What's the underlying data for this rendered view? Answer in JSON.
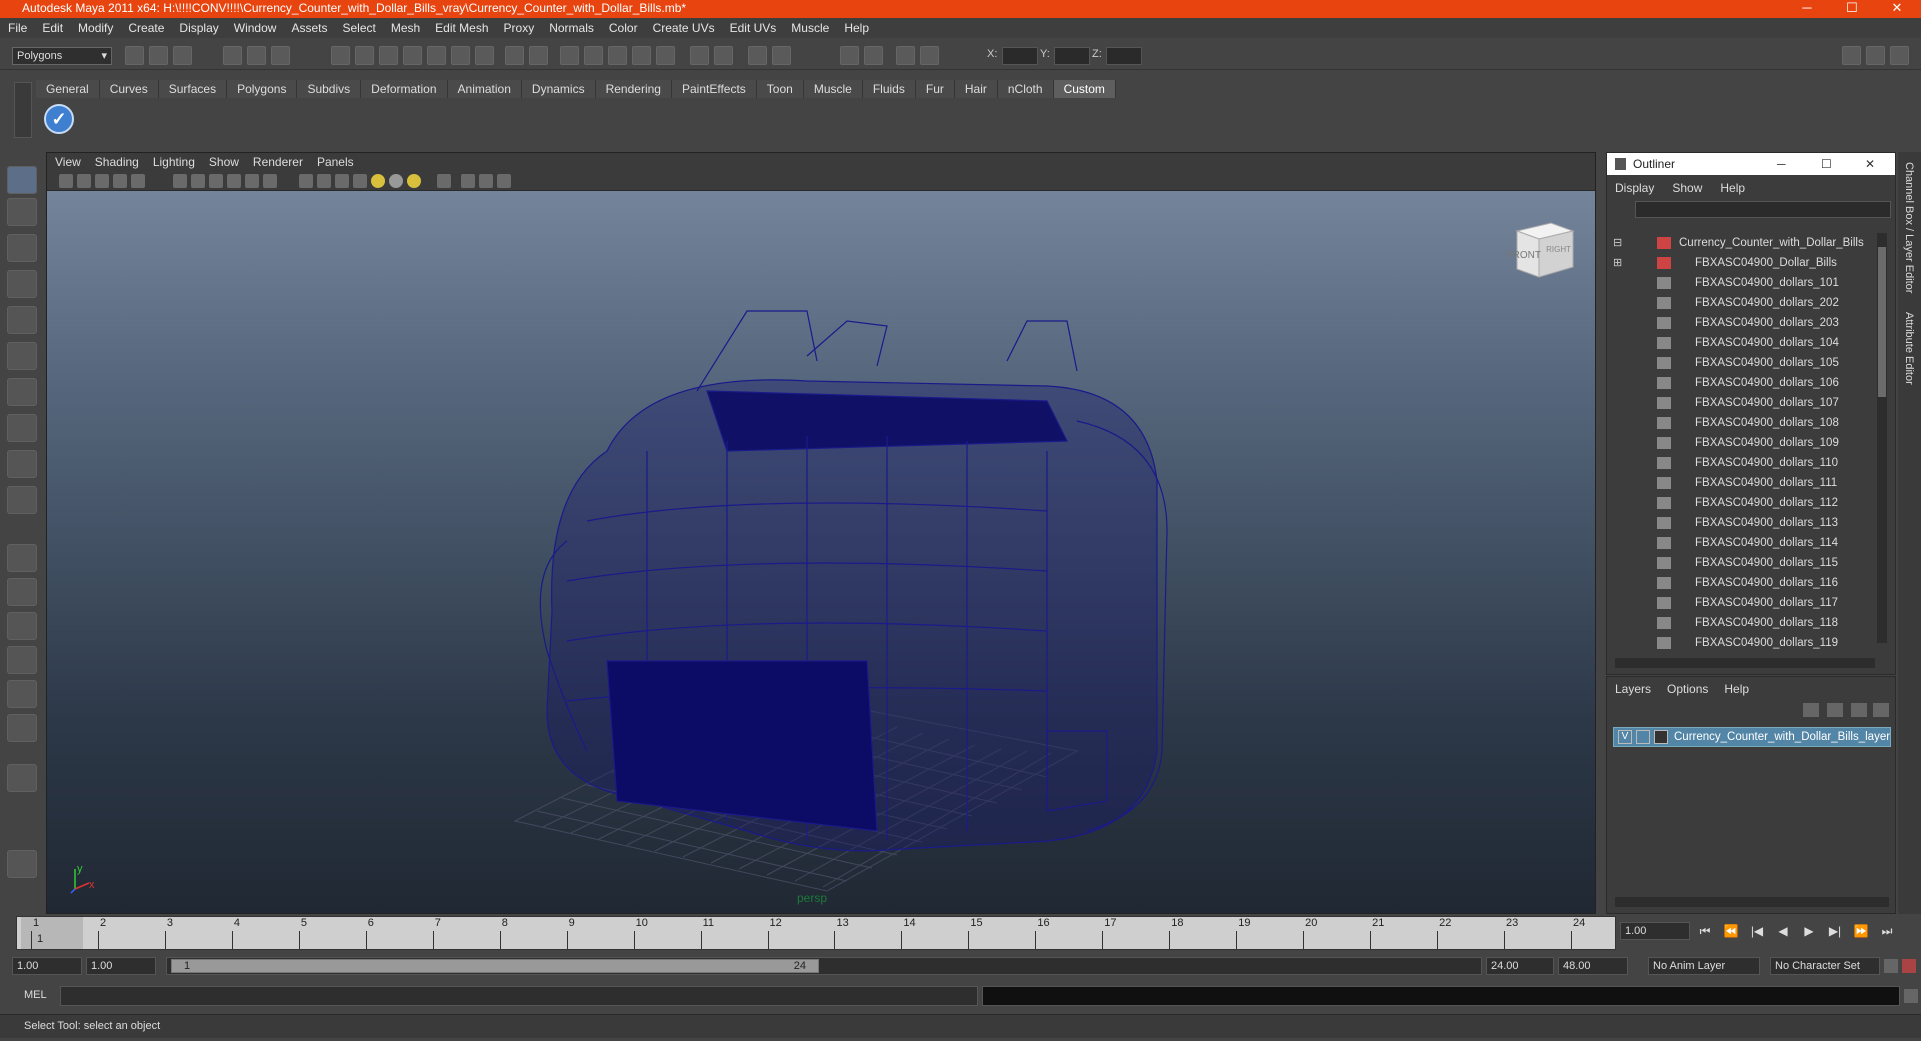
{
  "window": {
    "title": "Autodesk Maya 2011 x64: H:\\!!!!CONV!!!!\\Currency_Counter_with_Dollar_Bills_vray\\Currency_Counter_with_Dollar_Bills.mb*",
    "minimize": "─",
    "maximize": "☐",
    "close": "✕"
  },
  "menubar": [
    "File",
    "Edit",
    "Modify",
    "Create",
    "Display",
    "Window",
    "Assets",
    "Select",
    "Mesh",
    "Edit Mesh",
    "Proxy",
    "Normals",
    "Color",
    "Create UVs",
    "Edit UVs",
    "Muscle",
    "Help"
  ],
  "toolbar": {
    "menu_set": "Polygons",
    "x_label": "X:",
    "y_label": "Y:",
    "z_label": "Z:"
  },
  "shelf_tabs": [
    "General",
    "Curves",
    "Surfaces",
    "Polygons",
    "Subdivs",
    "Deformation",
    "Animation",
    "Dynamics",
    "Rendering",
    "PaintEffects",
    "Toon",
    "Muscle",
    "Fluids",
    "Fur",
    "Hair",
    "nCloth",
    "Custom"
  ],
  "shelf_active": "Custom",
  "viewport": {
    "menu": [
      "View",
      "Shading",
      "Lighting",
      "Show",
      "Renderer",
      "Panels"
    ],
    "camera_label": "persp",
    "viewcube_front": "FRONT",
    "viewcube_side": "RIGHT",
    "axis_y": "y",
    "axis_x": "x"
  },
  "outliner": {
    "title": "Outliner",
    "menu": [
      "Display",
      "Show",
      "Help"
    ],
    "root": "Currency_Counter_with_Dollar_Bills",
    "group": "FBXASC04900_Dollar_Bills",
    "items": [
      "FBXASC04900_dollars_101",
      "FBXASC04900_dollars_202",
      "FBXASC04900_dollars_203",
      "FBXASC04900_dollars_104",
      "FBXASC04900_dollars_105",
      "FBXASC04900_dollars_106",
      "FBXASC04900_dollars_107",
      "FBXASC04900_dollars_108",
      "FBXASC04900_dollars_109",
      "FBXASC04900_dollars_110",
      "FBXASC04900_dollars_111",
      "FBXASC04900_dollars_112",
      "FBXASC04900_dollars_113",
      "FBXASC04900_dollars_114",
      "FBXASC04900_dollars_115",
      "FBXASC04900_dollars_116",
      "FBXASC04900_dollars_117",
      "FBXASC04900_dollars_118",
      "FBXASC04900_dollars_119"
    ]
  },
  "layers": {
    "menu": [
      "Layers",
      "Options",
      "Help"
    ],
    "layer_visible": "V",
    "layer_name": "Currency_Counter_with_Dollar_Bills_layer"
  },
  "side_tabs": {
    "channel": "Channel Box / Layer Editor",
    "attribute": "Attribute Editor"
  },
  "timeline": {
    "ticks": [
      "1",
      "2",
      "3",
      "4",
      "5",
      "6",
      "7",
      "8",
      "9",
      "10",
      "11",
      "12",
      "13",
      "14",
      "15",
      "16",
      "17",
      "18",
      "19",
      "20",
      "21",
      "22",
      "23",
      "24"
    ],
    "current_frame": "1",
    "current_field": "1.00"
  },
  "range": {
    "start": "1.00",
    "playback_start": "1.00",
    "range_start_label": "1",
    "range_end_label": "24",
    "playback_end": "24.00",
    "end": "48.00",
    "anim_layer": "No Anim Layer",
    "character_set": "No Character Set"
  },
  "mel_label": "MEL",
  "status": "Select Tool: select an object"
}
